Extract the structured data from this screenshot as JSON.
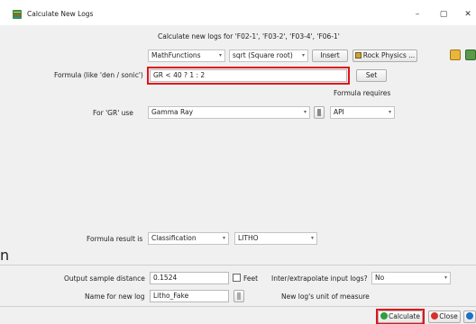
{
  "window": {
    "title": "Calculate New Logs",
    "minimize_glyph": "–",
    "maximize_glyph": "▢",
    "close_glyph": "✕"
  },
  "header": {
    "text": "Calculate new logs for 'F02-1', 'F03-2', 'F03-4', 'F06-1'"
  },
  "toolbar": {
    "functions_selected": "MathFunctions",
    "math_selected": "sqrt (Square root)",
    "insert_label": "Insert",
    "rock_physics_label": "Rock Physics ..."
  },
  "formula": {
    "label": "Formula (like 'den / sonic')",
    "value": "GR < 40 ? 1 : 2",
    "set_label": "Set",
    "requires_label": "Formula requires"
  },
  "input_gr": {
    "label": "For 'GR' use",
    "log_selected": "Gamma Ray",
    "unit_selected": "API"
  },
  "result": {
    "label": "Formula result is",
    "type_selected": "Classification",
    "kind_selected": "LITHO"
  },
  "output": {
    "sample_distance_label": "Output sample distance",
    "sample_distance_value": "0.1524",
    "feet_label": "Feet",
    "interp_label": "Inter/extrapolate input logs?",
    "interp_value": "No",
    "name_label": "Name for new log",
    "name_value": "Litho_Fake",
    "unit_label": "New log's unit of measure"
  },
  "buttons": {
    "calculate": "Calculate",
    "close": "Close"
  },
  "side_text": "n",
  "colors": {
    "highlight": "#e1141b",
    "calculate_icon": "#2e9e3e",
    "close_icon": "#d4332c",
    "help_icon": "#1f6fc2"
  }
}
